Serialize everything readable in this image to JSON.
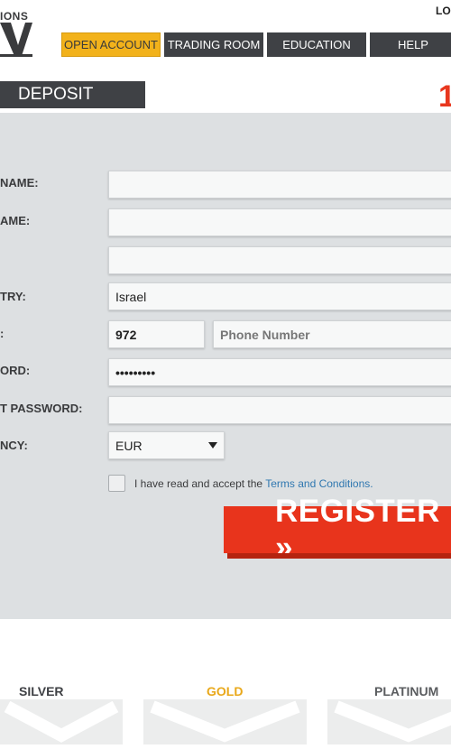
{
  "header": {
    "logo_text": "IONS",
    "login_label": "LO"
  },
  "nav": {
    "items": [
      {
        "label": "OPEN ACCOUNT",
        "active": true
      },
      {
        "label": "TRADING ROOM"
      },
      {
        "label": "EDUCATION"
      },
      {
        "label": "HELP"
      }
    ]
  },
  "tabs": {
    "deposit_label": "DEPOSIT",
    "red_glyph": "1"
  },
  "form": {
    "labels": {
      "first_name": "NAME:",
      "last_name": "AME:",
      "country": "TRY:",
      "phone": ":",
      "password": "ORD:",
      "confirm_password": "T PASSWORD:",
      "currency": "NCY:"
    },
    "fields": {
      "first_name": "",
      "last_name": "",
      "email": "",
      "country": "Israel",
      "phone_code": "972",
      "phone_placeholder": "Phone Number",
      "password": "•••••••••",
      "confirm_password": "",
      "currency": "EUR"
    },
    "terms_text": "I have read and accept the ",
    "terms_link": "Terms and Conditions.",
    "register_label": "REGISTER »"
  },
  "tiers": [
    {
      "name": "SILVER"
    },
    {
      "name": "GOLD"
    },
    {
      "name": "PLATINUM"
    }
  ],
  "colors": {
    "accent_red": "#e8341c",
    "nav_active": "#f2b21b",
    "nav_dark": "#3f4145",
    "panel_bg": "#dde0e2",
    "gold": "#e9a81a",
    "link": "#2f77b0"
  }
}
